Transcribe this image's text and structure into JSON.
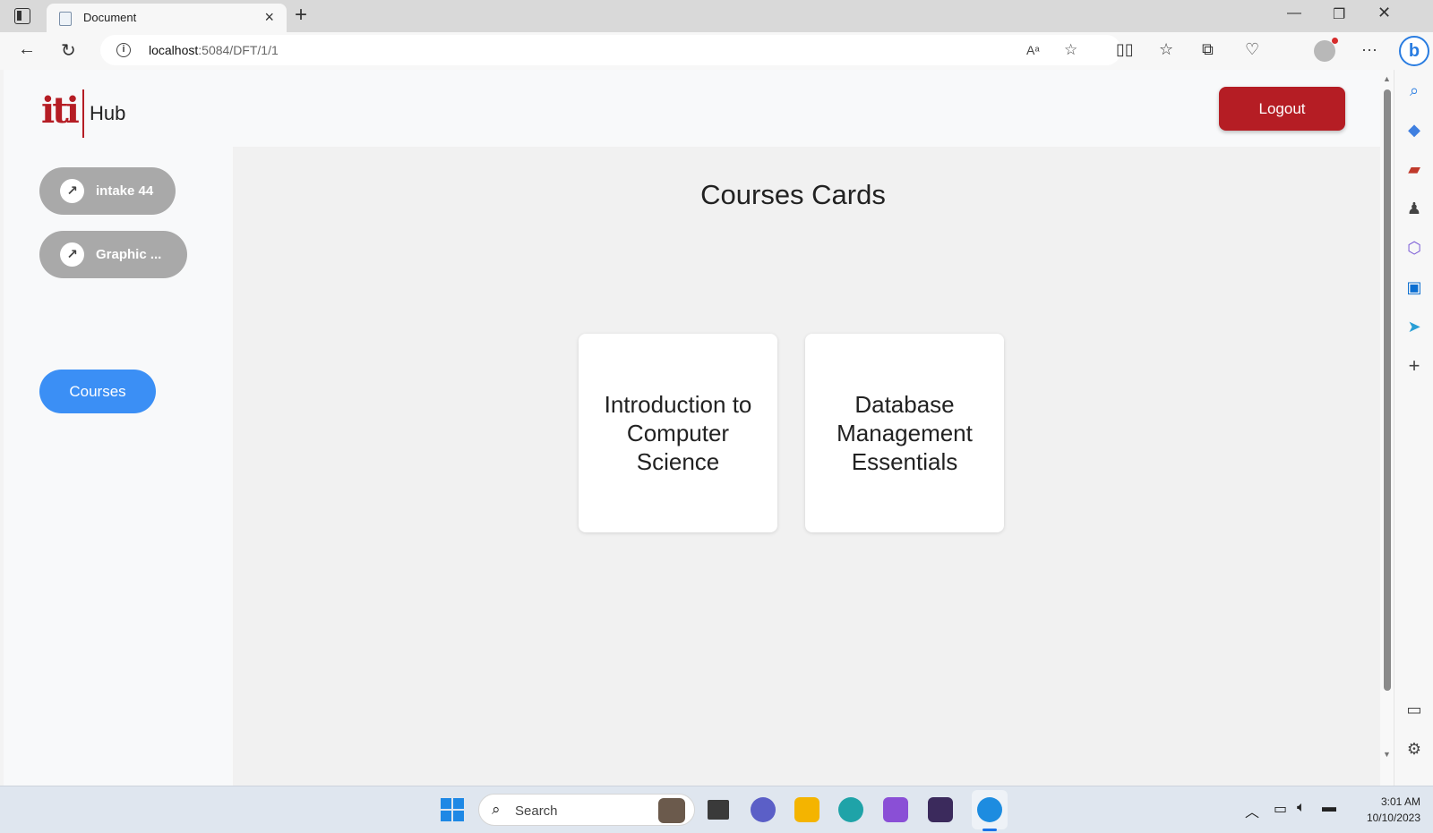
{
  "browser": {
    "tab_title": "Document",
    "url_host": "localhost",
    "url_path": ":5084/DFT/1/1"
  },
  "header": {
    "logo_text": "iti",
    "brand_label": "Hub",
    "logout_label": "Logout"
  },
  "sidebar": {
    "items": [
      {
        "label": "intake 44",
        "icon": "arrow-up-right-icon"
      },
      {
        "label": "Graphic ...",
        "icon": "arrow-up-right-icon"
      }
    ],
    "courses_label": "Courses"
  },
  "main": {
    "title": "Courses Cards",
    "cards": [
      {
        "title": "Introduction to Computer Science"
      },
      {
        "title": "Database Management Essentials"
      }
    ]
  },
  "taskbar": {
    "search_placeholder": "Search",
    "time": "3:01 AM",
    "date": "10/10/2023"
  },
  "colors": {
    "brand": "#b51d24",
    "accent": "#3b8ff5",
    "pill": "#a9a9a9"
  }
}
